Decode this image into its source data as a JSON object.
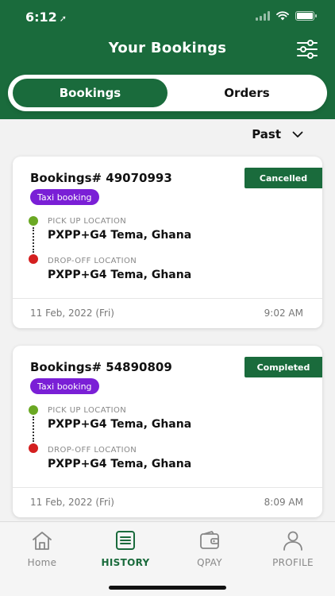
{
  "status_bar": {
    "time": "6:12",
    "location_arrow": "➚"
  },
  "header": {
    "title": "Your Bookings",
    "filter_icon": "sliders-icon"
  },
  "segment": {
    "tabs": [
      {
        "label": "Bookings",
        "active": true
      },
      {
        "label": "Orders",
        "active": false
      }
    ]
  },
  "filter": {
    "selected": "Past"
  },
  "bookings": [
    {
      "title": "Bookings# 49070993",
      "status": "Cancelled",
      "type": "Taxi booking",
      "pickup_label": "PICK UP LOCATION",
      "pickup": "PXPP+G4 Tema, Ghana",
      "dropoff_label": "DROP-OFF LOCATION",
      "dropoff": "PXPP+G4 Tema, Ghana",
      "date": "11 Feb, 2022 (Fri)",
      "time": "9:02 AM"
    },
    {
      "title": "Bookings# 54890809",
      "status": "Completed",
      "type": "Taxi booking",
      "pickup_label": "PICK UP LOCATION",
      "pickup": "PXPP+G4 Tema, Ghana",
      "dropoff_label": "DROP-OFF LOCATION",
      "dropoff": "PXPP+G4 Tema, Ghana",
      "date": "11 Feb, 2022 (Fri)",
      "time": "8:09 AM"
    }
  ],
  "nav": [
    {
      "label": "Home",
      "icon": "home-icon",
      "active": false
    },
    {
      "label": "HISTORY",
      "icon": "history-icon",
      "active": true
    },
    {
      "label": "QPAY",
      "icon": "wallet-icon",
      "active": false
    },
    {
      "label": "PROFILE",
      "icon": "person-icon",
      "active": false
    }
  ],
  "colors": {
    "brand_green": "#1a6b3c",
    "taxi_badge": "#7a1fd6",
    "pickup_dot": "#6aa823",
    "dropoff_dot": "#d41f1f"
  }
}
